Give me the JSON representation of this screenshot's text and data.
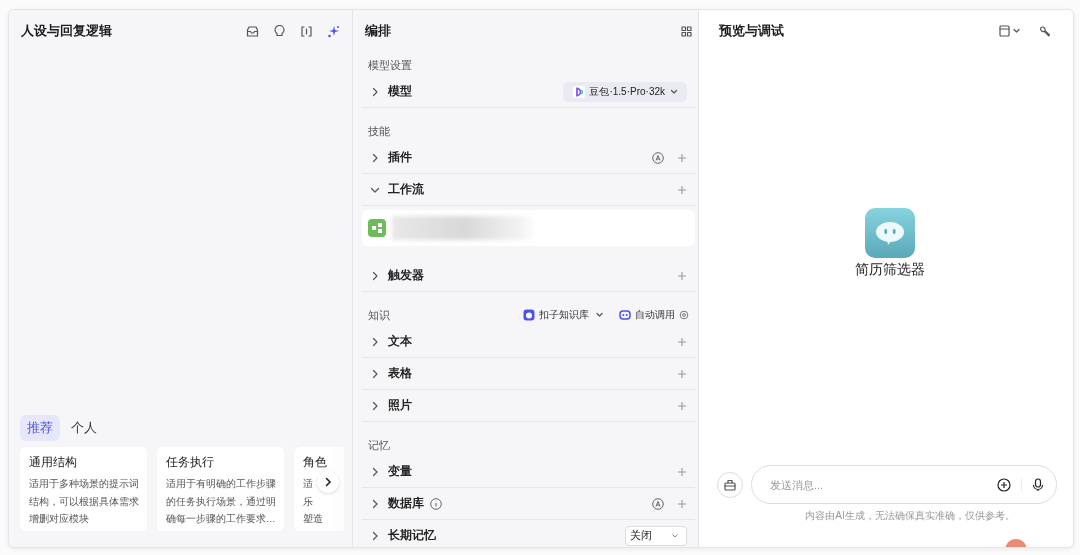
{
  "left_panel": {
    "title": "人设与回复逻辑",
    "tabs": [
      {
        "label": "推荐",
        "selected": true
      },
      {
        "label": "个人",
        "selected": false
      }
    ],
    "templates": [
      {
        "title": "通用结构",
        "lines": [
          "适用于多种场景的提示词",
          "结构，可以根据具体需求",
          "增删对应模块"
        ]
      },
      {
        "title": "任务执行",
        "lines": [
          "适用于有明确的工作步骤",
          "的任务执行场景，通过明",
          "确每一步骤的工作要求…"
        ]
      },
      {
        "title": "角色",
        "lines": [
          "适",
          "乐",
          "塑造"
        ]
      }
    ]
  },
  "middle_panel": {
    "title": "编排",
    "sections": [
      {
        "heading": "模型设置",
        "rows": [
          {
            "kind": "model",
            "label": "模型",
            "expanded": false,
            "model": "豆包·1.5·Pro·32k"
          }
        ]
      },
      {
        "heading": "技能",
        "rows": [
          {
            "kind": "add",
            "label": "插件",
            "expanded": false,
            "auto": true
          },
          {
            "kind": "add",
            "label": "工作流",
            "expanded": true,
            "auto": false
          },
          {
            "kind": "add",
            "label": "触发器",
            "expanded": false,
            "auto": false
          }
        ]
      },
      {
        "heading": "知识",
        "source": "扣子知识库",
        "mode": "自动调用",
        "rows": [
          {
            "kind": "add",
            "label": "文本",
            "expanded": false,
            "auto": false
          },
          {
            "kind": "add",
            "label": "表格",
            "expanded": false,
            "auto": false
          },
          {
            "kind": "add",
            "label": "照片",
            "expanded": false,
            "auto": false
          }
        ]
      },
      {
        "heading": "记忆",
        "rows": [
          {
            "kind": "add",
            "label": "变量",
            "expanded": false,
            "auto": false
          },
          {
            "kind": "info",
            "label": "数据库",
            "expanded": false,
            "auto": true
          },
          {
            "kind": "select",
            "label": "长期记忆",
            "expanded": false,
            "value": "关闭"
          }
        ]
      }
    ]
  },
  "right_panel": {
    "title": "预览与调试",
    "bot_name": "简历筛选器",
    "input": {
      "placeholder": "发送消息..."
    },
    "disclaimer": "内容由AI生成，无法确保真实准确，仅供参考。"
  }
}
